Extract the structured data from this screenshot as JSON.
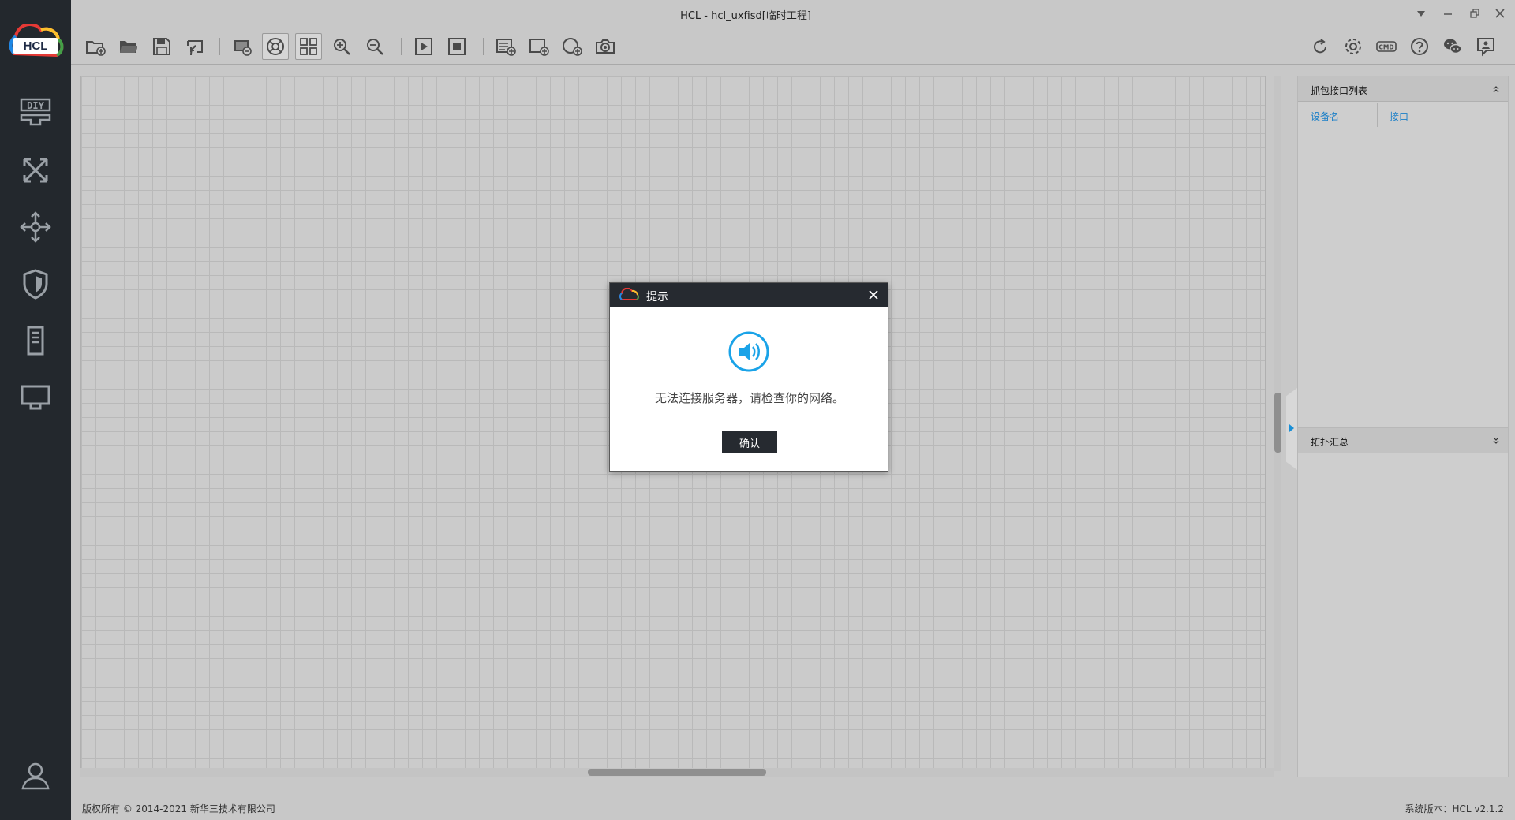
{
  "window": {
    "title": "HCL - hcl_uxfisd[临时工程]",
    "controls": [
      "dropdown-icon",
      "minimize-icon",
      "restore-icon",
      "close-icon"
    ]
  },
  "sidebar": {
    "logo_text": "HCL",
    "items": [
      {
        "name": "diy",
        "icon": "diy-icon"
      },
      {
        "name": "router",
        "icon": "router-icon"
      },
      {
        "name": "switch",
        "icon": "switch-icon"
      },
      {
        "name": "firewall",
        "icon": "shield-icon"
      },
      {
        "name": "server",
        "icon": "server-icon"
      },
      {
        "name": "terminal",
        "icon": "monitor-icon"
      }
    ],
    "user_icon": "user-icon"
  },
  "toolbar": {
    "left": [
      "new-project-icon",
      "open-folder-icon",
      "save-icon",
      "export-icon",
      "screenshot-icon",
      "globe-icon",
      "grid-icon",
      "zoom-in-icon",
      "zoom-out-icon",
      "start-icon",
      "stop-icon",
      "list-add-icon",
      "rect-add-icon",
      "circle-add-icon",
      "camera-icon"
    ],
    "right": [
      "refresh-icon",
      "gear-icon",
      "cmd-icon",
      "help-icon",
      "wechat-icon",
      "feedback-icon"
    ],
    "cmd_label": "CMD"
  },
  "right_panel": {
    "capture_list": {
      "title": "抓包接口列表",
      "columns": [
        "设备名",
        "接口"
      ]
    },
    "topology_summary": {
      "title": "拓扑汇总"
    }
  },
  "statusbar": {
    "copyright": "版权所有 © 2014-2021 新华三技术有限公司",
    "version": "系统版本：HCL v2.1.2"
  },
  "dialog": {
    "title": "提示",
    "message": "无法连接服务器，请检查你的网络。",
    "ok_label": "确认"
  },
  "colors": {
    "sidebar_bg": "#23282d",
    "accent_blue": "#1a8fd6",
    "dialog_title_bg": "#262a30"
  }
}
